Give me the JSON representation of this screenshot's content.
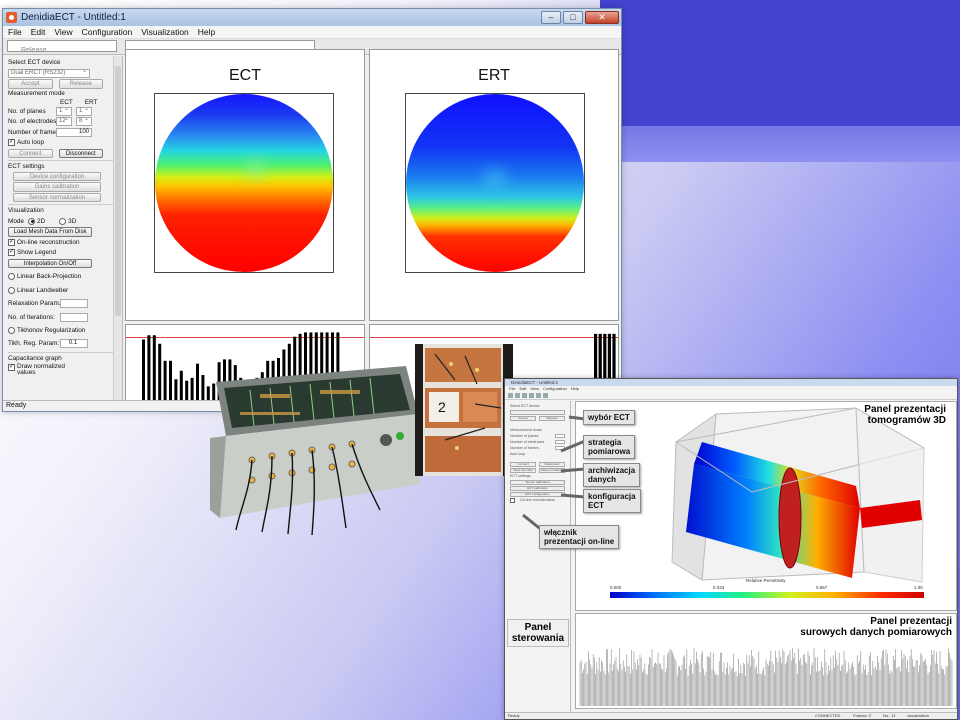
{
  "main_window": {
    "title": "DenidiaECT - Untitled:1",
    "menu": [
      "File",
      "Edit",
      "View",
      "Configuration",
      "Visualization",
      "Help"
    ],
    "ghost_tab_label": "Release",
    "status": "Ready",
    "left_panel": {
      "select_device_label": "Select ECT device",
      "device_value": "Dual ERCT (RS232)",
      "accept_label": "Accept",
      "release_label": "Release",
      "measurement_mode_label": "Measurement mode",
      "col_ect": "ECT",
      "col_ert": "ERT",
      "planes_label": "No. of planes",
      "planes_ect": "1",
      "planes_ert": "1",
      "electrodes_label": "No. of electrodes",
      "electrodes_ect": "12",
      "electrodes_ert": "8",
      "frames_label": "Number of frames",
      "frames_value": "100",
      "auto_loop_label": "Auto loop",
      "connect_label": "Connect",
      "disconnect_label": "Disconnect",
      "ect_settings_label": "ECT settings",
      "device_config_label": "Device configuration",
      "gains_calibration_label": "Gains calibration",
      "sensor_norm_label": "Sensor normalization",
      "visualization_label": "Visualization",
      "mode_label": "Mode",
      "mode_2d": "2D",
      "mode_3d": "3D",
      "load_mesh_label": "Load Mesh Data From Disk",
      "online_recon_label": "On-line reconstruction",
      "show_legend_label": "Show Legend",
      "interpolation_label": "Interpolation On/Off",
      "lbp_label": "Linear Back-Projection",
      "landweber_label": "Linear Landweber",
      "relaxation_label": "Relaxation Param.:",
      "iterations_label": "No. of Iterations:",
      "tikhonov_label": "Tikhonov Regularization",
      "tikh_param_label": "Tikh. Reg. Param:",
      "tikh_param_value": "0.1",
      "cap_graph_label": "Capacitance graph",
      "draw_norm_label": "Draw normalized values"
    },
    "views": [
      {
        "title": "ECT"
      },
      {
        "title": "ERT"
      }
    ],
    "ect_bar_levels": [
      0.88,
      0.94,
      0.94,
      0.82,
      0.58,
      0.58,
      0.32,
      0.44,
      0.3,
      0.34,
      0.54,
      0.38,
      0.22,
      0.26,
      0.56,
      0.6,
      0.6,
      0.52,
      0.34,
      0.3,
      0.26,
      0.34,
      0.42,
      0.58,
      0.58,
      0.62,
      0.74,
      0.82,
      0.92,
      0.96,
      0.98,
      0.98,
      0.98,
      0.98,
      0.98,
      0.98,
      0.98
    ],
    "ert_bar_levels": [
      0.96,
      0.96,
      0.96,
      0.96,
      0.96
    ]
  },
  "annotated_window": {
    "title": "DenidiaECT - Untitled:1",
    "menu": [
      "File",
      "Edit",
      "View",
      "Configuration",
      "Help"
    ],
    "left_panel": {
      "select_device": "Select ECT device",
      "accept": "Accept",
      "release": "Release",
      "measurement_mode": "Measurement mode",
      "planes": "Number of planes",
      "electrodes": "Number of electrodes",
      "frames": "Number of frames",
      "auto_loop": "Auto loop",
      "connect": "Connect",
      "disconnect": "Disconnect",
      "save_raw": "Save raw data",
      "save_normalized": "Save normalized",
      "ect_settings": "ECT settings",
      "sensor_calibration": "Sensor calibration",
      "ect_calibration": "ECT calibration",
      "ect_configuration": "ECT configuration",
      "online_recon": "On-line reconstruction"
    },
    "callouts": {
      "ect_choice": "wybór ECT",
      "strategy": "strategia\npomiarowa",
      "archive": "archiwizacja\ndanych",
      "config": "konfiguracja\nECT",
      "online_switch": "włącznik\nprezentacji on-line",
      "control_panel": "Panel\nsterowania"
    },
    "panel_3d_title": "Panel prezentacji\ntomogramów 3D",
    "raw_panel_title": "Panel prezentacji\nsurowych danych pomiarowych",
    "colorbar_title": "Relative Permittivity",
    "colorbar_ticks": [
      "0.000",
      "0.333",
      "0.667",
      "1.00"
    ],
    "status": {
      "left": "Ready",
      "connected": "CONNECTED",
      "frames": "Frames: 2",
      "no": "No.: 11",
      "mode": "visualization"
    }
  },
  "colors": {
    "title_bar": "#a9c3e3",
    "accent_blue": "#4343cf",
    "copper": "#c6723f",
    "chassis": "#c9cec9"
  }
}
